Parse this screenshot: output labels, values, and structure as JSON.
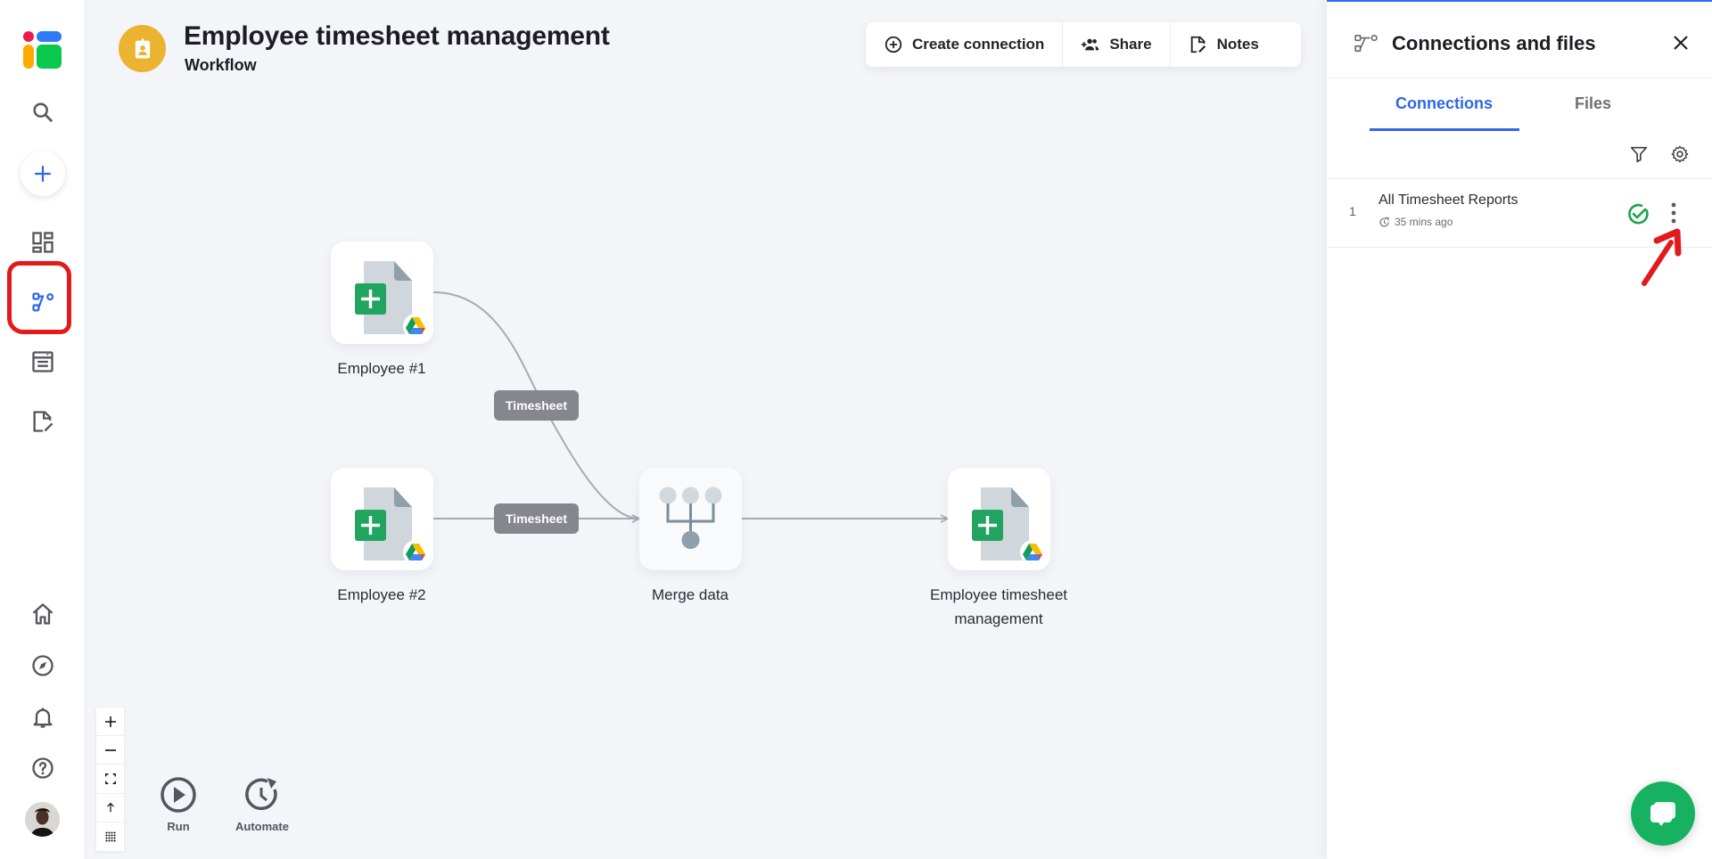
{
  "sidebar": {
    "items": [
      {
        "name": "search",
        "icon": "search-icon"
      },
      {
        "name": "create",
        "icon": "plus-icon"
      },
      {
        "name": "dashboards",
        "icon": "dashboard-icon"
      },
      {
        "name": "workflows",
        "icon": "workflow-icon",
        "active": true
      },
      {
        "name": "tables",
        "icon": "table-icon"
      },
      {
        "name": "forms",
        "icon": "form-edit-icon"
      },
      {
        "name": "home",
        "icon": "home-icon"
      },
      {
        "name": "explore",
        "icon": "compass-icon"
      },
      {
        "name": "notifications",
        "icon": "bell-icon"
      },
      {
        "name": "help",
        "icon": "help-icon"
      },
      {
        "name": "profile",
        "icon": "avatar"
      }
    ],
    "accent_color": "#2e67e8"
  },
  "header": {
    "title": "Employee timesheet management",
    "subtitle": "Workflow",
    "badge_icon": "id-badge-icon",
    "badge_color": "#ebb32f"
  },
  "toolbar": {
    "create_connection_label": "Create connection",
    "share_label": "Share",
    "notes_label": "Notes"
  },
  "canvas": {
    "nodes": [
      {
        "id": "emp1",
        "label": "Employee #1",
        "type": "google-sheet"
      },
      {
        "id": "emp2",
        "label": "Employee #2",
        "type": "google-sheet"
      },
      {
        "id": "merge",
        "label": "Merge data",
        "type": "merge"
      },
      {
        "id": "out",
        "label": "Employee timesheet management",
        "type": "google-sheet"
      }
    ],
    "edges": [
      {
        "from": "emp1",
        "to": "merge",
        "label": "Timesheet"
      },
      {
        "from": "emp2",
        "to": "merge",
        "label": "Timesheet"
      },
      {
        "from": "merge",
        "to": "out",
        "label": ""
      }
    ],
    "zoom_controls": [
      "zoom-in",
      "zoom-out",
      "fit-view",
      "auto-layout",
      "grid"
    ],
    "actions": {
      "run_label": "Run",
      "automate_label": "Automate"
    }
  },
  "panel": {
    "title": "Connections and files",
    "tabs": [
      {
        "label": "Connections",
        "active": true
      },
      {
        "label": "Files",
        "active": false
      }
    ],
    "connections": [
      {
        "index": "1",
        "name": "All Timesheet Reports",
        "time": "35 mins ago",
        "status": "ok",
        "status_color": "#18a34a"
      }
    ]
  },
  "chat": {
    "icon": "chat-icon",
    "color": "#16b161"
  }
}
